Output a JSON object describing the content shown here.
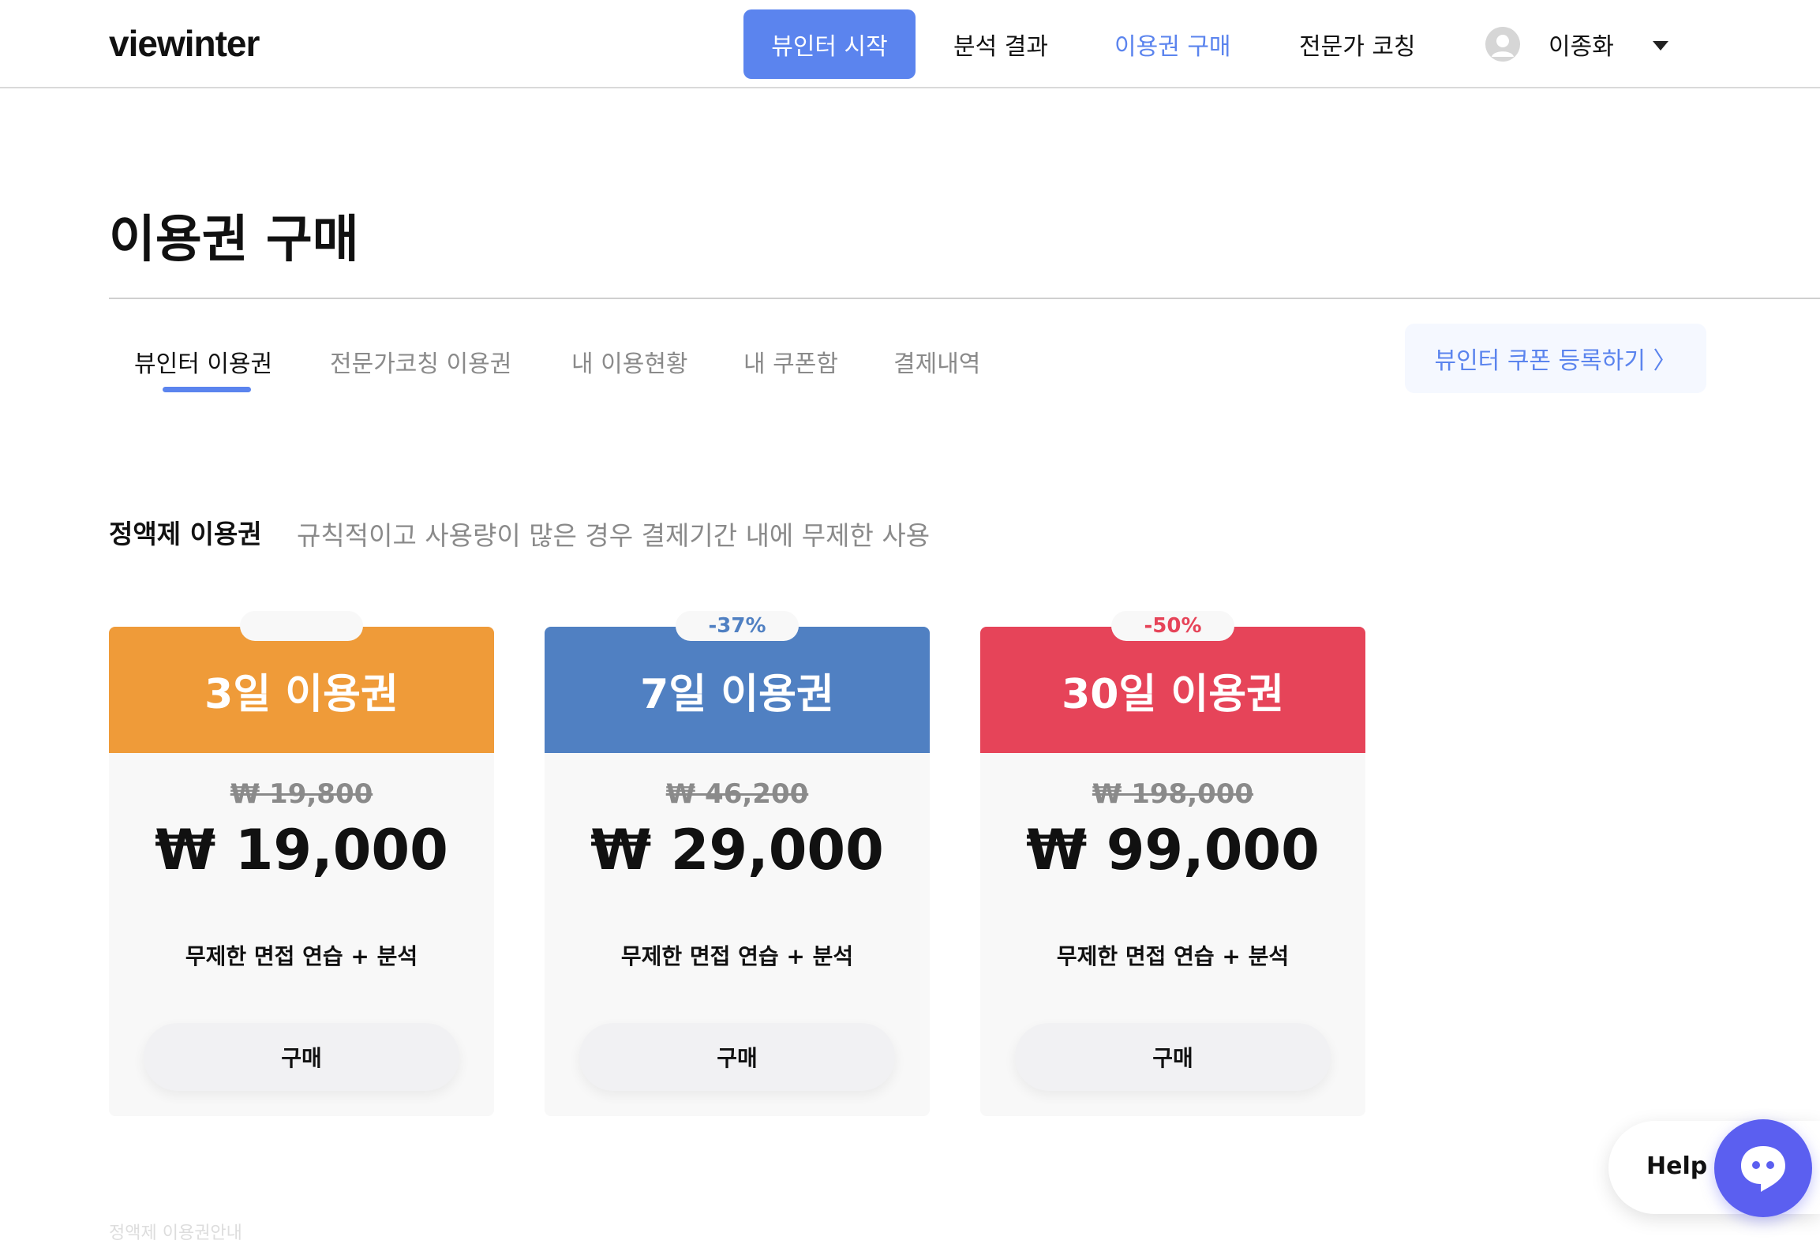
{
  "header": {
    "logo": "viewinter",
    "start_button": "뷰인터 시작",
    "nav": [
      {
        "label": "분석 결과"
      },
      {
        "label": "이용권 구매"
      },
      {
        "label": "전문가 코칭"
      }
    ],
    "active_nav": "이용권 구매",
    "user_name": "이종화",
    "icons": {
      "avatar": "user-avatar-icon",
      "caret": "caret-down-icon"
    }
  },
  "page": {
    "title": "이용권 구매"
  },
  "tabs": [
    {
      "label": "뷰인터 이용권"
    },
    {
      "label": "전문가코칭 이용권"
    },
    {
      "label": "내 이용현황"
    },
    {
      "label": "내 쿠폰함"
    },
    {
      "label": "결제내역"
    }
  ],
  "active_tab": "뷰인터 이용권",
  "coupon_button": "뷰인터 쿠폰 등록하기 〉",
  "section": {
    "title": "정액제 이용권",
    "description": "규칙적이고 사용량이 많은 경우 결제기간 내에 무제한 사용"
  },
  "plans": [
    {
      "name": "3일 이용권",
      "badge": "",
      "original_price": "₩ 19,800",
      "price": "₩ 19,000",
      "feature": "무제한 면접 연습 + 분석",
      "buy_label": "구매",
      "color": "#ef9b39"
    },
    {
      "name": "7일 이용권",
      "badge": "-37%",
      "original_price": "₩ 46,200",
      "price": "₩ 29,000",
      "feature": "무제한 면접 연습 + 분석",
      "buy_label": "구매",
      "color": "#5080c2"
    },
    {
      "name": "30일 이용권",
      "badge": "-50%",
      "original_price": "₩ 198,000",
      "price": "₩ 99,000",
      "feature": "무제한 면접 연습 + 분석",
      "buy_label": "구매",
      "color": "#e64459"
    }
  ],
  "help": {
    "label": "Help",
    "icon": "chat-bubble-icon"
  },
  "footer_hint": "정액제 이용권안내",
  "colors": {
    "accent": "#5b84ee",
    "help": "#5b5ff0"
  }
}
